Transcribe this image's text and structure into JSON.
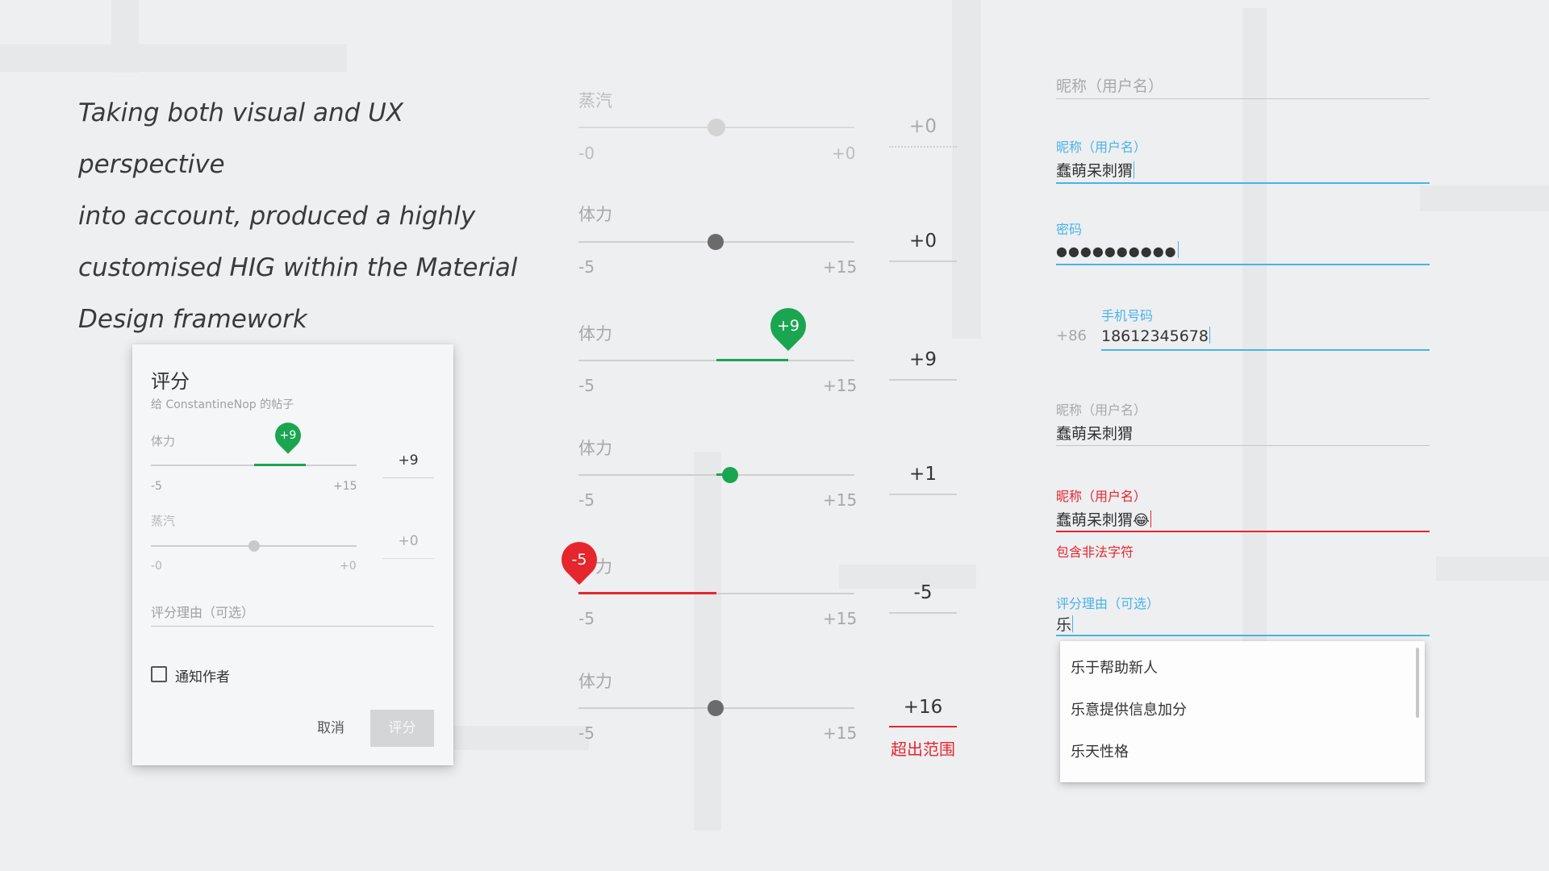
{
  "intro": {
    "lines": [
      "Taking both visual and UX perspective",
      "into account, produced a highly",
      "customised HIG within the Material",
      "Design framework"
    ]
  },
  "dialog": {
    "title": "评分",
    "subtitle": "给 ConstantineNop 的帖子",
    "slider1": {
      "label": "体力",
      "bubble": "+9",
      "min": "-5",
      "max": "+15",
      "value": "+9",
      "value_num": 9,
      "min_num": -5,
      "max_num": 15
    },
    "slider2": {
      "label": "蒸汽",
      "min": "-0",
      "max": "+0",
      "value": "+0",
      "value_num": 0
    },
    "reason_placeholder": "评分理由（可选）",
    "notify_label": "通知作者",
    "cancel_label": "取消",
    "submit_label": "评分"
  },
  "sliders": [
    {
      "label": "蒸汽",
      "min": "-0",
      "max": "+0",
      "value": "+0",
      "state": "disabled"
    },
    {
      "label": "体力",
      "min": "-5",
      "max": "+15",
      "value": "+0",
      "state": "idle"
    },
    {
      "label": "体力",
      "min": "-5",
      "max": "+15",
      "value": "+9",
      "bubble": "+9",
      "state": "dragging"
    },
    {
      "label": "体力",
      "min": "-5",
      "max": "+15",
      "value": "+1",
      "state": "active"
    },
    {
      "label": "力",
      "min": "-5",
      "max": "+15",
      "value": "-5",
      "bubble": "-5",
      "state": "min"
    },
    {
      "label": "体力",
      "min": "-5",
      "max": "+15",
      "value": "+16",
      "error": "超出范围",
      "state": "error"
    }
  ],
  "fields": {
    "f1": {
      "hint": "昵称（用户名）"
    },
    "f2": {
      "label": "昵称（用户名）",
      "value": "蠢萌呆刺猬"
    },
    "f3": {
      "label": "密码",
      "value": "●●●●●●●●●●"
    },
    "f4": {
      "prefix": "+86",
      "label": "手机号码",
      "value": "18612345678"
    },
    "f5": {
      "label": "昵称（用户名）",
      "value": "蠢萌呆刺猬"
    },
    "f6": {
      "label": "昵称（用户名）",
      "value": "蠢萌呆刺猬",
      "emoji": "😂",
      "error": "包含非法字符"
    },
    "f7": {
      "label": "评分理由（可选）",
      "value": "乐"
    }
  },
  "suggestions": [
    "乐于帮助新人",
    "乐意提供信息加分",
    "乐天性格"
  ],
  "colors": {
    "green": "#1aa551",
    "red": "#e5262d",
    "blue": "#4ab3e6",
    "grey_track": "#cfcfcf"
  }
}
